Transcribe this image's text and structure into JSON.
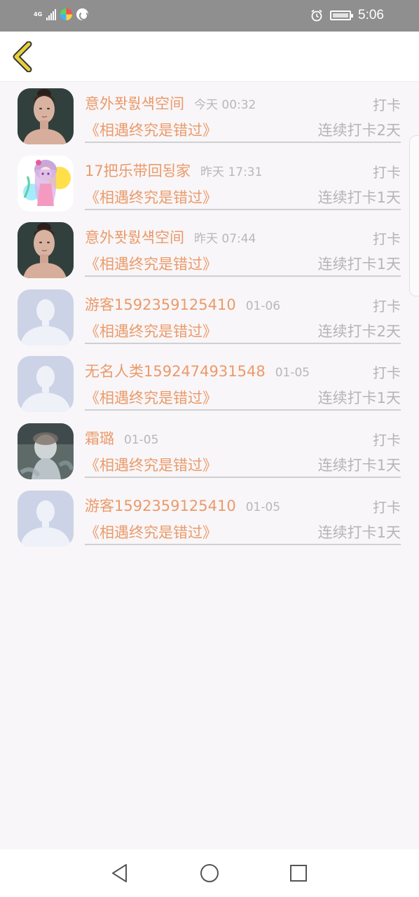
{
  "status_bar": {
    "network_label": "4G",
    "time": "5:06",
    "icons": [
      "signal-icon",
      "colorful-app-icon",
      "sync-app-icon",
      "alarm-icon",
      "battery-icon"
    ]
  },
  "header": {
    "back_icon": "chevron-left-icon",
    "accent": "#e7cf3d"
  },
  "checkins": [
    {
      "username": "意外퐛뤐섁空间",
      "time": "今天 00:32",
      "action": "打卡",
      "song": "《相遇终究是错过》",
      "streak": "连续打卡2天",
      "avatar": "photo-woman"
    },
    {
      "username": "17把乐带回됭家",
      "time": "昨天 17:31",
      "action": "打卡",
      "song": "《相遇终究是错过》",
      "streak": "连续打卡1天",
      "avatar": "anime-girl"
    },
    {
      "username": "意外퐛뤐섁空间",
      "time": "昨天 07:44",
      "action": "打卡",
      "song": "《相遇终究是错过》",
      "streak": "连续打卡1天",
      "avatar": "photo-woman"
    },
    {
      "username": "游客1592359125410",
      "time": "01-06",
      "action": "打卡",
      "song": "《相遇终究是错过》",
      "streak": "连续打卡2天",
      "avatar": "default-person"
    },
    {
      "username": "无名人类1592474931548",
      "time": "01-05",
      "action": "打卡",
      "song": "《相遇终究是错过》",
      "streak": "连续打卡1天",
      "avatar": "default-person"
    },
    {
      "username": "霜璐",
      "time": "01-05",
      "action": "打卡",
      "song": "《相遇终究是错过》",
      "streak": "连续打卡1天",
      "avatar": "photo-blurry"
    },
    {
      "username": "游客1592359125410",
      "time": "01-05",
      "action": "打卡",
      "song": "《相遇终究是错过》",
      "streak": "连续打卡1天",
      "avatar": "default-person"
    }
  ],
  "colors": {
    "name_color": "#eb9a6a",
    "muted_text": "#b5b5b5",
    "status_bar_bg": "#8f8f8f",
    "page_bg": "#f8f6f8"
  },
  "nav_bar": {
    "buttons": [
      "back-triangle-icon",
      "home-circle-icon",
      "recents-square-icon"
    ]
  }
}
